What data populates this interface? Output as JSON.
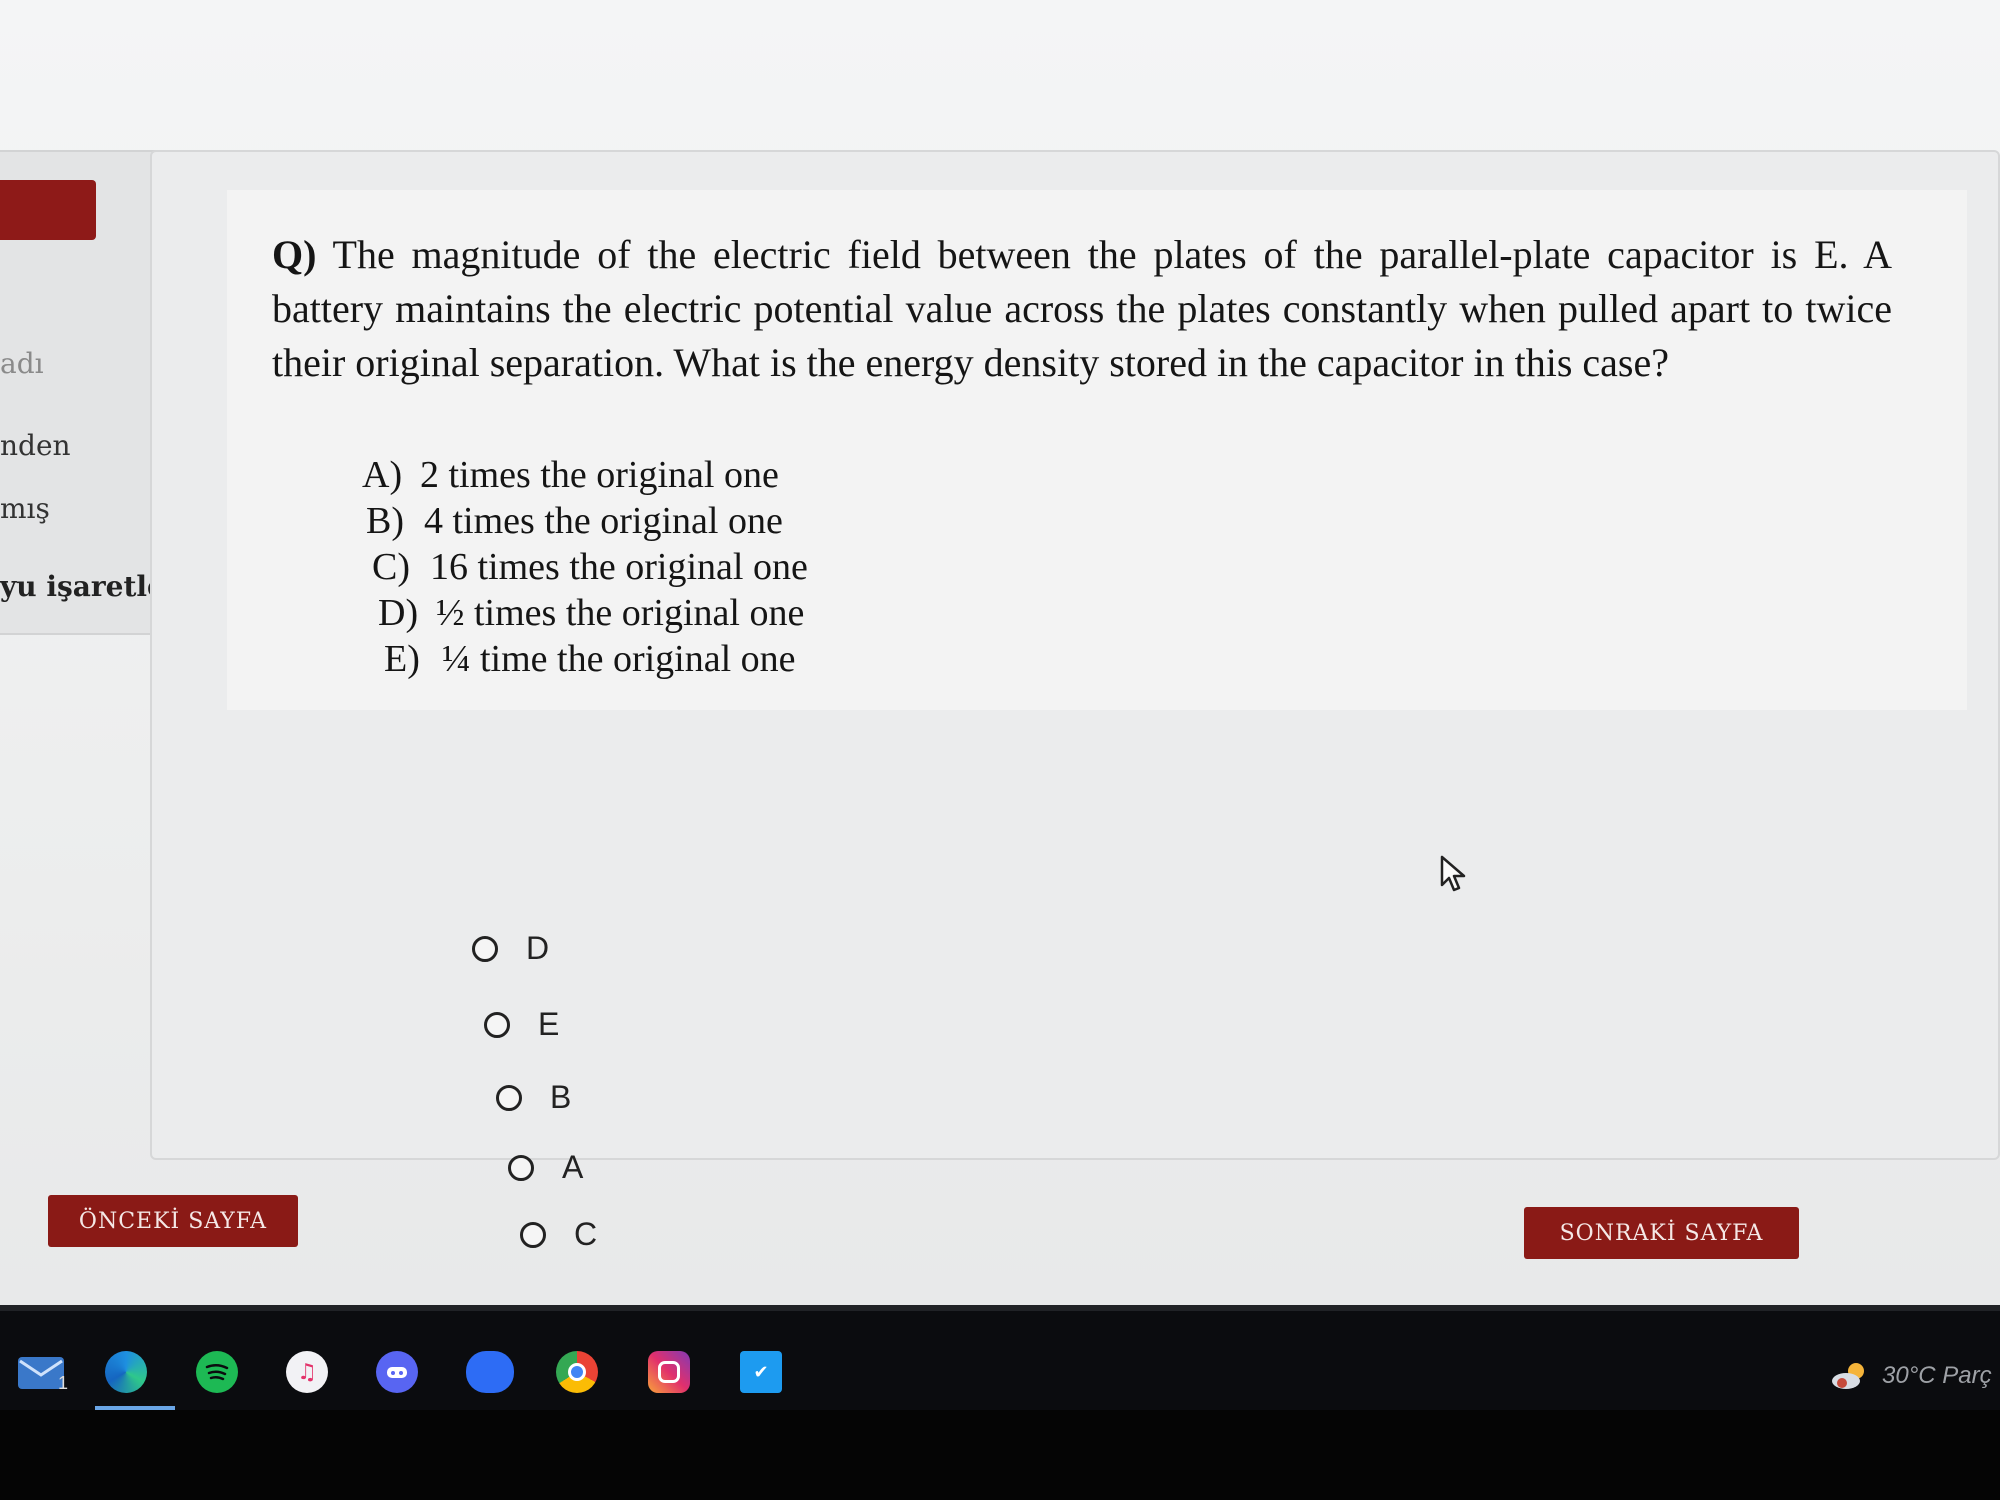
{
  "sidebar": {
    "items": [
      "adı",
      "nden",
      "mış",
      "yu işaretle"
    ]
  },
  "question": {
    "prefix": "Q)",
    "text": "The magnitude of the electric field between the plates of the parallel-plate capacitor is E. A battery maintains the electric potential value across the plates constantly when pulled apart to twice their original separation. What is the energy density stored in the capacitor in this case?",
    "options": [
      {
        "letter": "A)",
        "text": "2 times the original one"
      },
      {
        "letter": "B)",
        "text": "4 times the original one"
      },
      {
        "letter": "C)",
        "text": "16 times the original one"
      },
      {
        "letter": "D)",
        "text": "½ times the original one"
      },
      {
        "letter": "E)",
        "text": "¼ time the original one"
      }
    ]
  },
  "answers": [
    "D",
    "E",
    "B",
    "A",
    "C"
  ],
  "nav": {
    "prev_label": "ÖNCEKİ SAYFA",
    "next_label": "SONRAKİ SAYFA"
  },
  "taskbar": {
    "mail_badge": "1",
    "weather": "30°C  Parç",
    "icons": [
      "mail-icon",
      "edge-icon",
      "spotify-icon",
      "itunes-icon",
      "discord-icon",
      "zoom-icon",
      "chrome-icon",
      "instagram-icon",
      "twitter-icon"
    ]
  },
  "colors": {
    "accent": "#8a1a16",
    "background": "#eceded",
    "taskbar": "#0b0c0f"
  }
}
